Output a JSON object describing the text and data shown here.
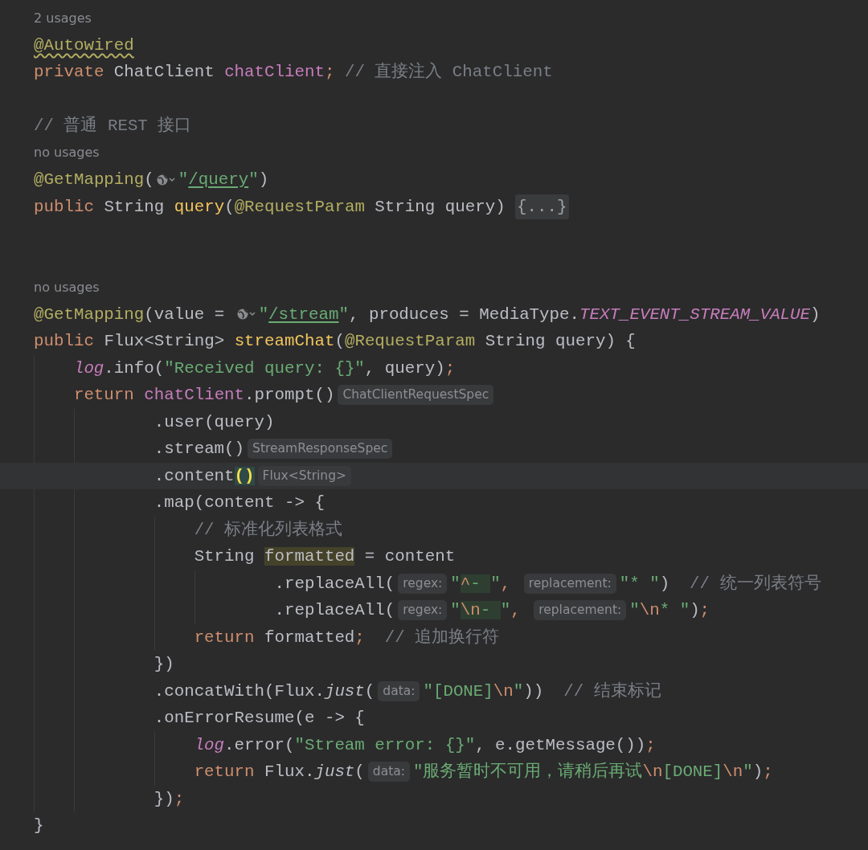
{
  "editor": {
    "lines": [
      {
        "kind": "usage",
        "text": "2 usages"
      },
      {
        "kind": "code",
        "current": false,
        "tokens": [
          {
            "text": "@Autowired",
            "kind": "annot",
            "warn": true
          }
        ]
      },
      {
        "kind": "code",
        "current": false,
        "tokens": [
          {
            "text": "private ",
            "kind": "kw"
          },
          {
            "text": "ChatClient ",
            "kind": "plain"
          },
          {
            "text": "chatClient",
            "kind": "field"
          },
          {
            "text": ";",
            "kind": "kw"
          },
          {
            "text": " // 直接注入 ChatClient",
            "kind": "comment"
          }
        ]
      },
      {
        "kind": "blank"
      },
      {
        "kind": "code",
        "current": false,
        "tokens": [
          {
            "text": "// 普通 REST 接口",
            "kind": "comment"
          }
        ]
      },
      {
        "kind": "usage",
        "text": "no usages"
      },
      {
        "kind": "code",
        "current": false,
        "tokens": [
          {
            "text": "@GetMapping",
            "kind": "annot"
          },
          {
            "text": "(",
            "kind": "plain"
          },
          {
            "kind": "globe"
          },
          {
            "text": "\"",
            "kind": "str"
          },
          {
            "text": "/query",
            "kind": "url"
          },
          {
            "text": "\"",
            "kind": "str"
          },
          {
            "text": ")",
            "kind": "plain"
          }
        ]
      },
      {
        "kind": "code",
        "current": false,
        "tokens": [
          {
            "text": "public ",
            "kind": "kw"
          },
          {
            "text": "String ",
            "kind": "plain"
          },
          {
            "text": "query",
            "kind": "fn"
          },
          {
            "text": "(",
            "kind": "plain"
          },
          {
            "text": "@RequestParam",
            "kind": "annot"
          },
          {
            "text": " String query) ",
            "kind": "plain"
          },
          {
            "text": "{...}",
            "kind": "fold"
          }
        ]
      },
      {
        "kind": "blank"
      },
      {
        "kind": "blank"
      },
      {
        "kind": "usage",
        "text": "no usages"
      },
      {
        "kind": "code",
        "current": false,
        "tokens": [
          {
            "text": "@GetMapping",
            "kind": "annot"
          },
          {
            "text": "(value = ",
            "kind": "plain"
          },
          {
            "kind": "globe"
          },
          {
            "text": "\"",
            "kind": "str"
          },
          {
            "text": "/stream",
            "kind": "url"
          },
          {
            "text": "\"",
            "kind": "str"
          },
          {
            "text": ", produces = MediaType.",
            "kind": "plain"
          },
          {
            "text": "TEXT_EVENT_STREAM_VALUE",
            "kind": "const"
          },
          {
            "text": ")",
            "kind": "plain"
          }
        ]
      },
      {
        "kind": "code",
        "current": false,
        "continuation": false,
        "tokens": [
          {
            "text": "public ",
            "kind": "kw"
          },
          {
            "text": "Flux<String> ",
            "kind": "plain"
          },
          {
            "text": "streamChat",
            "kind": "fn"
          },
          {
            "text": "(",
            "kind": "plain"
          },
          {
            "text": "@RequestParam",
            "kind": "annot"
          },
          {
            "text": " String query) {",
            "kind": "plain"
          }
        ],
        "children": [
          {
            "kind": "code",
            "current": false,
            "tokens": [
              {
                "text": "log",
                "kind": "log"
              },
              {
                "text": ".info(",
                "kind": "plain"
              },
              {
                "text": "\"Received query: {}\"",
                "kind": "str"
              },
              {
                "text": ", query)",
                "kind": "plain"
              },
              {
                "text": ";",
                "kind": "kw"
              }
            ]
          },
          {
            "kind": "code",
            "current": false,
            "continuation": true,
            "tokens": [
              {
                "text": "return ",
                "kind": "kw"
              },
              {
                "text": "chatClient",
                "kind": "field"
              },
              {
                "text": ".prompt()",
                "kind": "plain"
              },
              {
                "text": "ChatClientRequestSpec",
                "kind": "hint"
              }
            ],
            "children": [
              {
                "kind": "code",
                "current": false,
                "tokens": [
                  {
                    "text": ".user(query)",
                    "kind": "plain"
                  }
                ]
              },
              {
                "kind": "code",
                "current": false,
                "tokens": [
                  {
                    "text": ".stream()",
                    "kind": "plain"
                  },
                  {
                    "text": "StreamResponseSpec",
                    "kind": "hint"
                  }
                ]
              },
              {
                "kind": "code",
                "current": true,
                "tokens": [
                  {
                    "text": ".content",
                    "kind": "plain"
                  },
                  {
                    "text": "()",
                    "kind": "match"
                  },
                  {
                    "text": "Flux<String>",
                    "kind": "hint"
                  }
                ]
              },
              {
                "kind": "code",
                "current": false,
                "continuation": false,
                "tokens": [
                  {
                    "text": ".map(content -> {",
                    "kind": "plain"
                  }
                ],
                "children": [
                  {
                    "kind": "code",
                    "current": false,
                    "tokens": [
                      {
                        "text": "// 标准化列表格式",
                        "kind": "comment"
                      }
                    ]
                  },
                  {
                    "kind": "code",
                    "current": false,
                    "continuation": true,
                    "tokens": [
                      {
                        "text": "String ",
                        "kind": "plain"
                      },
                      {
                        "text": "formatted",
                        "kind": "plain",
                        "highlighted": true
                      },
                      {
                        "text": " = content",
                        "kind": "plain"
                      }
                    ],
                    "children": [
                      {
                        "kind": "code",
                        "current": false,
                        "tokens": [
                          {
                            "text": ".replaceAll(",
                            "kind": "plain"
                          },
                          {
                            "text": "regex:",
                            "kind": "hint"
                          },
                          {
                            "text": "\"",
                            "kind": "str"
                          },
                          {
                            "text": "^",
                            "kind": "escape",
                            "highlighted": true
                          },
                          {
                            "text": "- ",
                            "kind": "str",
                            "highlighted": true
                          },
                          {
                            "text": "\"",
                            "kind": "str"
                          },
                          {
                            "text": ", ",
                            "kind": "kw"
                          },
                          {
                            "text": "replacement:",
                            "kind": "hint"
                          },
                          {
                            "text": "\"* \"",
                            "kind": "str"
                          },
                          {
                            "text": ")  ",
                            "kind": "plain"
                          },
                          {
                            "text": "// 统一列表符号",
                            "kind": "comment"
                          }
                        ]
                      },
                      {
                        "kind": "code",
                        "current": false,
                        "tokens": [
                          {
                            "text": ".replaceAll(",
                            "kind": "plain"
                          },
                          {
                            "text": "regex:",
                            "kind": "hint"
                          },
                          {
                            "text": "\"",
                            "kind": "str"
                          },
                          {
                            "text": "\\n",
                            "kind": "escape",
                            "highlighted": true
                          },
                          {
                            "text": "- ",
                            "kind": "str",
                            "highlighted": true
                          },
                          {
                            "text": "\"",
                            "kind": "str"
                          },
                          {
                            "text": ", ",
                            "kind": "kw"
                          },
                          {
                            "text": "replacement:",
                            "kind": "hint"
                          },
                          {
                            "text": "\"",
                            "kind": "str"
                          },
                          {
                            "text": "\\n",
                            "kind": "escape"
                          },
                          {
                            "text": "* \"",
                            "kind": "str"
                          },
                          {
                            "text": ")",
                            "kind": "plain"
                          },
                          {
                            "text": ";",
                            "kind": "kw"
                          }
                        ]
                      }
                    ]
                  },
                  {
                    "kind": "code",
                    "current": false,
                    "tokens": [
                      {
                        "text": "return ",
                        "kind": "kw"
                      },
                      {
                        "text": "formatted",
                        "kind": "plain"
                      },
                      {
                        "text": ";",
                        "kind": "kw"
                      },
                      {
                        "text": "  // 追加换行符",
                        "kind": "comment"
                      }
                    ]
                  }
                ]
              },
              {
                "kind": "code",
                "current": false,
                "tokens": [
                  {
                    "text": "})",
                    "kind": "plain"
                  }
                ]
              },
              {
                "kind": "code",
                "current": false,
                "tokens": [
                  {
                    "text": ".concatWith(Flux.",
                    "kind": "plain"
                  },
                  {
                    "text": "just",
                    "kind": "italic"
                  },
                  {
                    "text": "(",
                    "kind": "plain"
                  },
                  {
                    "text": "data:",
                    "kind": "hint"
                  },
                  {
                    "text": "\"[DONE]",
                    "kind": "str"
                  },
                  {
                    "text": "\\n",
                    "kind": "escape"
                  },
                  {
                    "text": "\"",
                    "kind": "str"
                  },
                  {
                    "text": "))  ",
                    "kind": "plain"
                  },
                  {
                    "text": "// 结束标记",
                    "kind": "comment"
                  }
                ]
              },
              {
                "kind": "code",
                "current": false,
                "continuation": false,
                "tokens": [
                  {
                    "text": ".onErrorResume(e -> {",
                    "kind": "plain"
                  }
                ],
                "children": [
                  {
                    "kind": "code",
                    "current": false,
                    "tokens": [
                      {
                        "text": "log",
                        "kind": "log"
                      },
                      {
                        "text": ".error(",
                        "kind": "plain"
                      },
                      {
                        "text": "\"Stream error: {}\"",
                        "kind": "str"
                      },
                      {
                        "text": ", e.getMessage())",
                        "kind": "plain"
                      },
                      {
                        "text": ";",
                        "kind": "kw"
                      }
                    ]
                  },
                  {
                    "kind": "code",
                    "current": false,
                    "tokens": [
                      {
                        "text": "return ",
                        "kind": "kw"
                      },
                      {
                        "text": "Flux.",
                        "kind": "plain"
                      },
                      {
                        "text": "just",
                        "kind": "italic"
                      },
                      {
                        "text": "(",
                        "kind": "plain"
                      },
                      {
                        "text": "data:",
                        "kind": "hint"
                      },
                      {
                        "text": "\"服务暂时不可用，请稍后再试",
                        "kind": "str"
                      },
                      {
                        "text": "\\n",
                        "kind": "escape"
                      },
                      {
                        "text": "[DONE]",
                        "kind": "str"
                      },
                      {
                        "text": "\\n",
                        "kind": "escape"
                      },
                      {
                        "text": "\"",
                        "kind": "str"
                      },
                      {
                        "text": ")",
                        "kind": "plain"
                      },
                      {
                        "text": ";",
                        "kind": "kw"
                      }
                    ]
                  }
                ]
              },
              {
                "kind": "code",
                "current": false,
                "tokens": [
                  {
                    "text": "})",
                    "kind": "plain"
                  },
                  {
                    "text": ";",
                    "kind": "kw"
                  }
                ]
              }
            ]
          }
        ]
      },
      {
        "kind": "code",
        "current": false,
        "tokens": [
          {
            "text": "}",
            "kind": "plain"
          }
        ]
      }
    ]
  }
}
